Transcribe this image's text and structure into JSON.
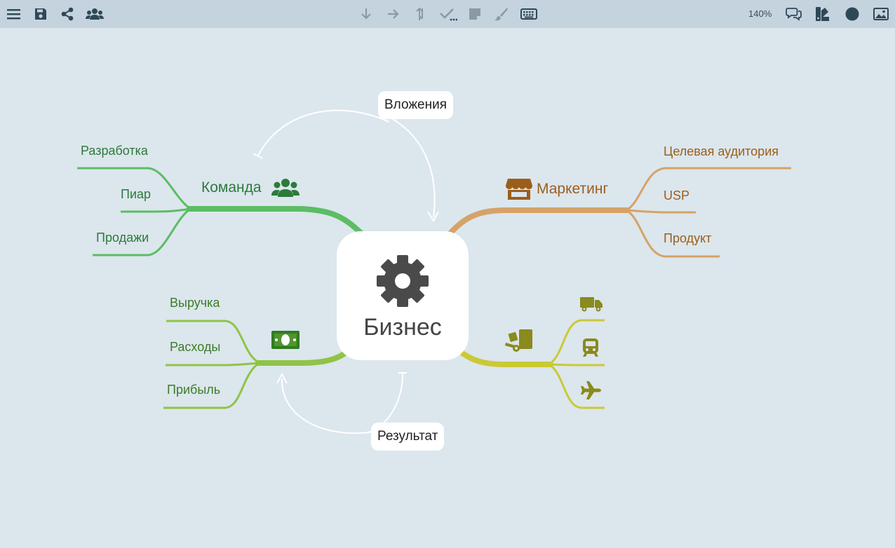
{
  "toolbar": {
    "left": [
      "menu-icon",
      "save-icon",
      "share-icon",
      "users-icon"
    ],
    "center": [
      "arrow-down-icon",
      "arrow-right-icon",
      "swap-vertical-icon",
      "checklist-icon",
      "sticky-note-icon",
      "brush-icon",
      "keyboard-icon"
    ],
    "zoom": "140%",
    "right": [
      "comments-icon",
      "palette-icon",
      "circle-icon",
      "image-icon"
    ]
  },
  "colors": {
    "background": "#dce6ed",
    "toolbar": "#c4d3de",
    "team_branch": "#5cbd64",
    "finance_branch": "#8fc446",
    "marketing_branch": "#d5a367",
    "logistics_branch": "#cbc934"
  },
  "central": {
    "title": "Бизнес",
    "icon": "gear-icon"
  },
  "branches": {
    "team": {
      "label": "Команда",
      "icon": "users-icon",
      "children": [
        "Разработка",
        "Пиар",
        "Продажи"
      ]
    },
    "marketing": {
      "label": "Маркетинг",
      "icon": "store-icon",
      "children": [
        "Целевая аудитория",
        "USP",
        "Продукт"
      ]
    },
    "finance": {
      "icon": "money-icon",
      "children": [
        "Выручка",
        "Расходы",
        "Прибыль"
      ]
    },
    "logistics": {
      "icon": "dolly-icon",
      "children_icons": [
        "truck-icon",
        "train-icon",
        "plane-icon"
      ]
    }
  },
  "relations": {
    "investments": "Вложения",
    "result": "Результат"
  }
}
